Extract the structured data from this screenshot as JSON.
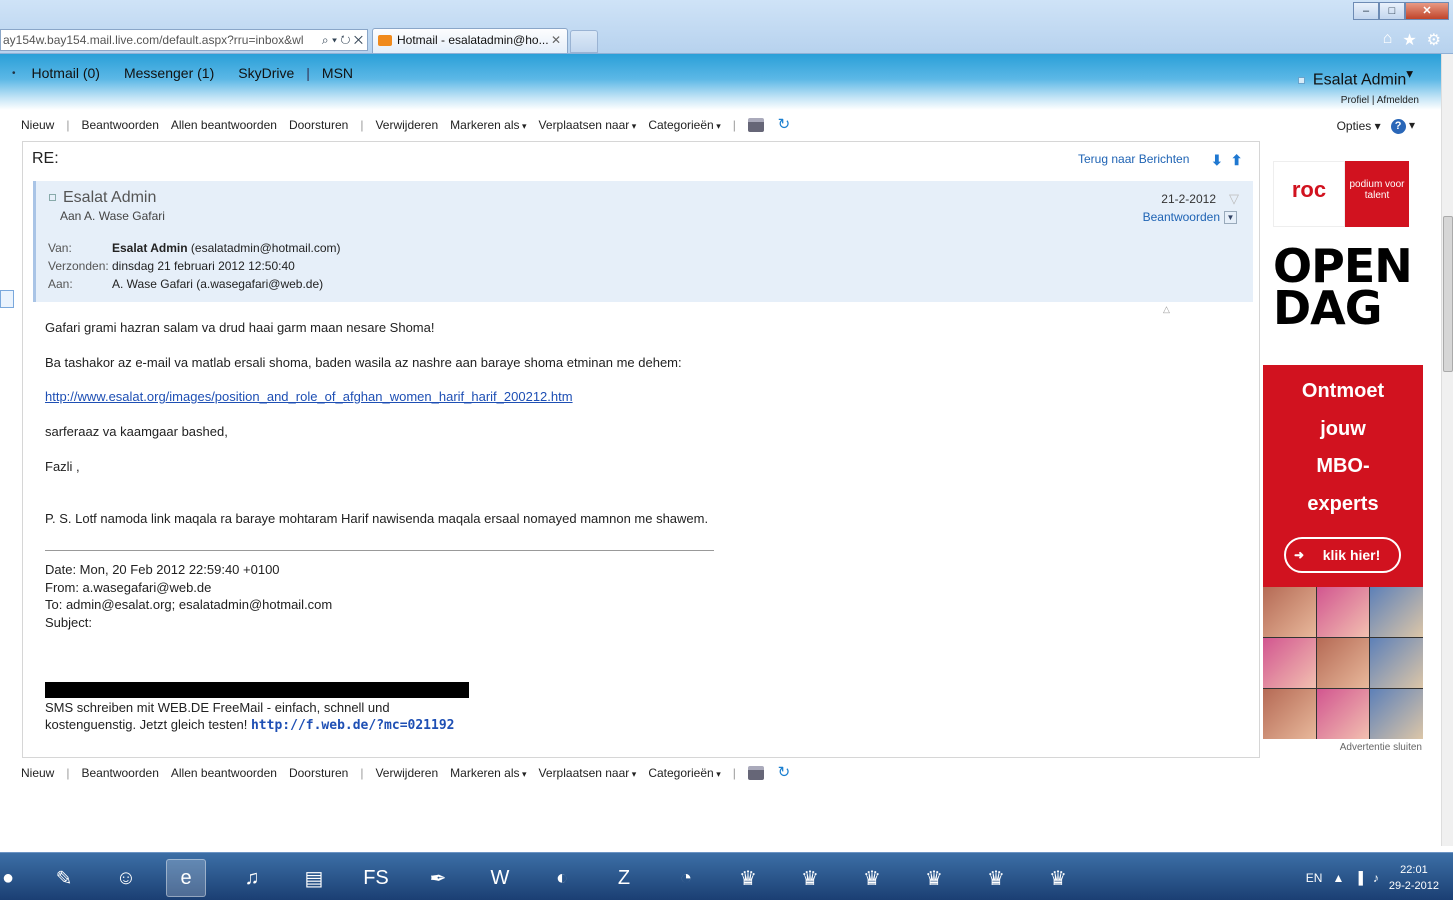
{
  "browser": {
    "address": "ay154w.bay154.mail.live.com/default.aspx?rru=inbox&wl",
    "address_domain": "live.com",
    "tab_title": "Hotmail - esalatadmin@ho...",
    "window_buttons": [
      "–",
      "□",
      "✕"
    ]
  },
  "header": {
    "nav": [
      "Hotmail (0)",
      "Messenger (1)",
      "SkyDrive",
      "MSN"
    ],
    "user_name": "Esalat Admin",
    "profile": "Profiel",
    "signout": "Afmelden"
  },
  "toolbar": {
    "new": "Nieuw",
    "reply": "Beantwoorden",
    "reply_all": "Allen beantwoorden",
    "forward": "Doorsturen",
    "delete": "Verwijderen",
    "mark_as": "Markeren als",
    "move_to": "Verplaatsen naar",
    "categories": "Categorieën",
    "options": "Opties"
  },
  "message": {
    "subject": "RE:",
    "back_link": "Terug naar Berichten",
    "sender": "Esalat Admin",
    "to_summary": "Aan A. Wase Gafari",
    "date_short": "21-2-2012",
    "reply_button": "Beantwoorden",
    "from_label": "Van:",
    "from_name": "Esalat Admin",
    "from_email": "(esalatadmin@hotmail.com)",
    "sent_label": "Verzonden:",
    "sent_value": "dinsdag 21 februari 2012 12:50:40",
    "to_label": "Aan:",
    "to_value": "A. Wase Gafari (a.wasegafari@web.de)",
    "body": {
      "line1": "Gafari grami hazran salam va drud haai garm maan nesare Shoma!",
      "line2": "Ba tashakor az e-mail va matlab ersali shoma, baden wasila az nashre aan baraye shoma etminan me dehem:",
      "link": "http://www.esalat.org/images/position_and_role_of_afghan_women_harif_harif_200212.htm",
      "line3": "sarferaaz va kaamgaar bashed,",
      "line4": "Fazli ,",
      "line5": "P. S. Lotf namoda link maqala ra baraye mohtaram Harif nawisenda maqala ersaal nomayed mamnon me shawem."
    },
    "quoted": {
      "date": "Date: Mon, 20 Feb 2012 22:59:40 +0100",
      "from": "From: a.wasegafari@web.de",
      "to": "To: admin@esalat.org; esalatadmin@hotmail.com",
      "subject": "Subject:"
    },
    "signature": {
      "line1": "SMS schreiben mit WEB.DE FreeMail - einfach, schnell und",
      "line2": "kostenguenstig. Jetzt gleich testen!",
      "link": "http://f.web.de/?mc=021192"
    }
  },
  "ad": {
    "logo": "roc",
    "podium": "podium voor talent",
    "headline1": "OPEN",
    "headline2": "DAG",
    "slogan": [
      "Ontmoet",
      "jouw",
      "MBO-",
      "experts"
    ],
    "cta": "klik hier!",
    "close": "Advertentie sluiten"
  },
  "taskbar": {
    "lang": "EN",
    "time": "22:01",
    "date": "29-2-2012",
    "fs_label": "FS"
  },
  "colors": {
    "link": "#1e63b4",
    "ad_red": "#d1121f",
    "header_blue": "#2a9fd8"
  }
}
